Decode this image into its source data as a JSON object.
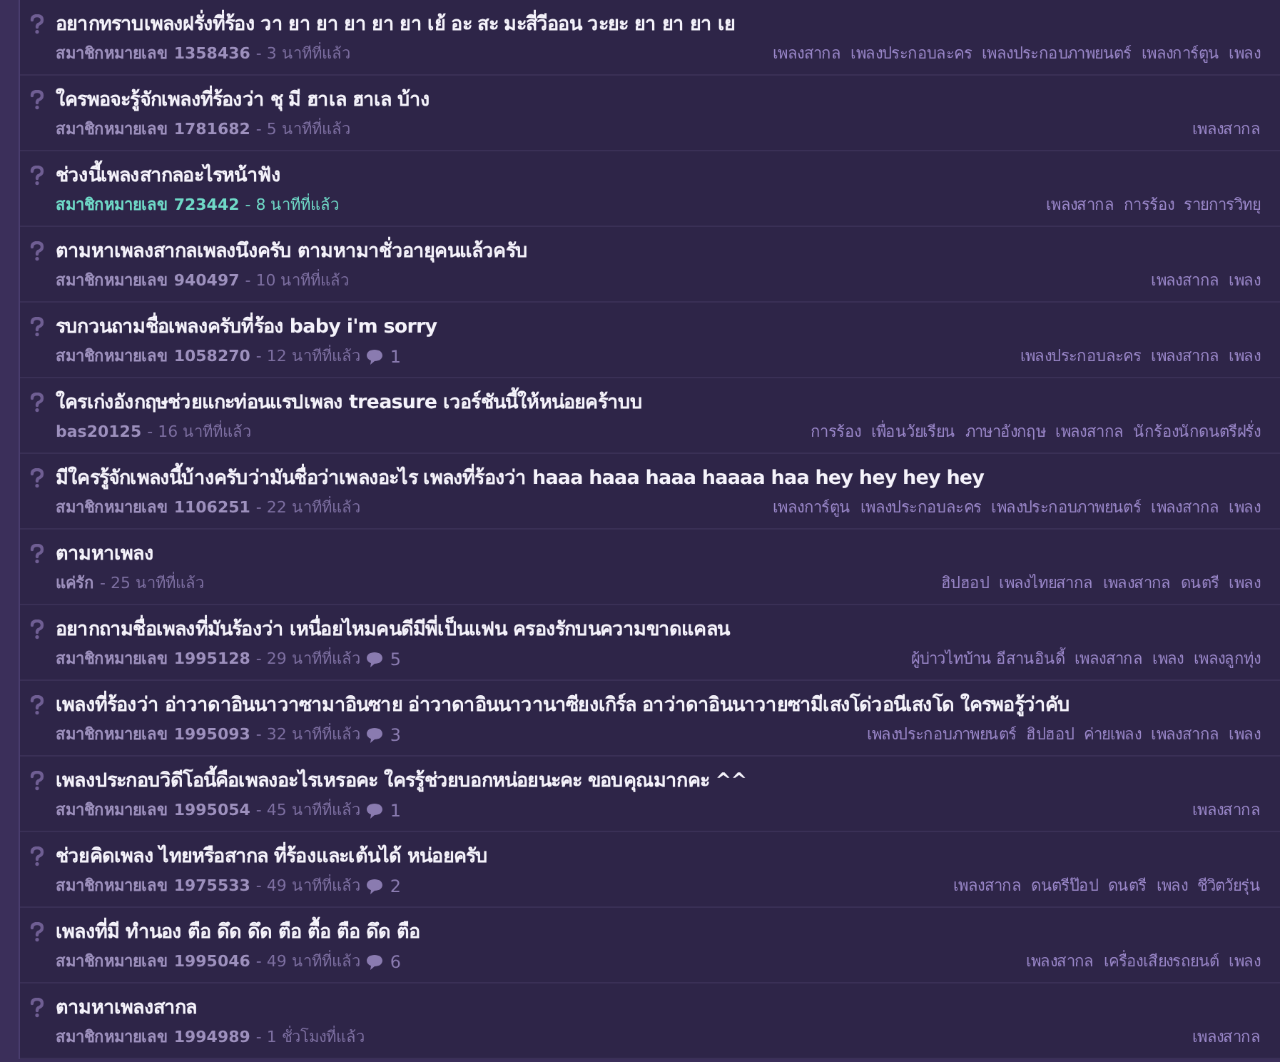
{
  "topics": [
    {
      "title": "อยากทราบเพลงฝรั่งที่ร้อง วา ยา ยา ยา ยา ยา เย้ อะ สะ มะสี่วีออน วะยะ ยา ยา ยา เย",
      "author": "สมาชิกหมายเลข 1358436",
      "time": "- 3 นาทีที่แล้ว",
      "highlighted": false,
      "tags": [
        "เพลงสากล",
        "เพลงประกอบละคร",
        "เพลงประกอบภาพยนตร์",
        "เพลงการ์ตูน",
        "เพลง"
      ]
    },
    {
      "title": "ใครพอจะรู้จักเพลงที่ร้องว่า ชุ มี ฮาเล ฮาเล บ้าง",
      "author": "สมาชิกหมายเลข 1781682",
      "time": "- 5 นาทีที่แล้ว",
      "highlighted": false,
      "tags": [
        "เพลงสากล"
      ]
    },
    {
      "title": "ช่วงนี้เพลงสากลอะไรหน้าฟัง",
      "author": "สมาชิกหมายเลข 723442",
      "time": "- 8 นาทีที่แล้ว",
      "highlighted": true,
      "tags": [
        "เพลงสากล",
        "การร้อง",
        "รายการวิทยุ"
      ]
    },
    {
      "title": "ตามหาเพลงสากลเพลงนึงครับ ตามหามาชั่วอายุคนแล้วครับ",
      "author": "สมาชิกหมายเลข 940497",
      "time": "- 10 นาทีที่แล้ว",
      "highlighted": false,
      "tags": [
        "เพลงสากล",
        "เพลง"
      ]
    },
    {
      "title": "รบกวนถามชื่อเพลงครับที่ร้อง baby i'm sorry",
      "author": "สมาชิกหมายเลข 1058270",
      "time": "- 12 นาทีที่แล้ว",
      "comments": "1",
      "highlighted": false,
      "tags": [
        "เพลงประกอบละคร",
        "เพลงสากล",
        "เพลง"
      ]
    },
    {
      "title": "ใครเก่งอังกฤษช่วยแกะท่อนแรปเพลง treasure เวอร์ชันนี้ให้หน่อยคร้าบบ",
      "author": "bas20125",
      "time": "- 16 นาทีที่แล้ว",
      "highlighted": false,
      "tags": [
        "การร้อง",
        "เพื่อนวัยเรียน",
        "ภาษาอังกฤษ",
        "เพลงสากล",
        "นักร้องนักดนตรีฝรั่ง"
      ]
    },
    {
      "title": "มีใครรู้จักเพลงนี้บ้างครับว่ามันชื่อว่าเพลงอะไร เพลงที่ร้องว่า haaa haaa haaa haaaa haa hey hey hey hey",
      "author": "สมาชิกหมายเลข 1106251",
      "time": "- 22 นาทีที่แล้ว",
      "highlighted": false,
      "tags": [
        "เพลงการ์ตูน",
        "เพลงประกอบละคร",
        "เพลงประกอบภาพยนตร์",
        "เพลงสากล",
        "เพลง"
      ]
    },
    {
      "title": "ตามหาเพลง",
      "author": "แค่รัก",
      "time": "- 25 นาทีที่แล้ว",
      "highlighted": false,
      "tags": [
        "ฮิปฮอป",
        "เพลงไทยสากล",
        "เพลงสากล",
        "ดนตรี",
        "เพลง"
      ]
    },
    {
      "title": "อยากถามชื่อเพลงที่มันร้องว่า เหนื่อยไหมคนดีมีพี่เป็นแฟน ครองรักบนความขาดแคลน",
      "author": "สมาชิกหมายเลข 1995128",
      "time": "- 29 นาทีที่แล้ว",
      "comments": "5",
      "highlighted": false,
      "tags": [
        "ผู้บ่าวไทบ้าน อีสานอินดี้",
        "เพลงสากล",
        "เพลง",
        "เพลงลูกทุ่ง"
      ]
    },
    {
      "title": "เพลงที่ร้องว่า อ่าวาดาอินนาวาซามาอินซาย อ่าวาดาอินนาวานาซียงเกิร์ล อาว่าดาอินนาวายซามีเสงโด่วอนีเสงโด ใครพอรู้ว่าคับ",
      "author": "สมาชิกหมายเลข 1995093",
      "time": "- 32 นาทีที่แล้ว",
      "comments": "3",
      "highlighted": false,
      "tags": [
        "เพลงประกอบภาพยนตร์",
        "ฮิปฮอป",
        "ค่ายเพลง",
        "เพลงสากล",
        "เพลง"
      ]
    },
    {
      "title": "เพลงประกอบวิดีโอนี้คือเพลงอะไรเหรอคะ ใครรู้ช่วยบอกหน่อยนะคะ ขอบคุณมากคะ ^^",
      "author": "สมาชิกหมายเลข 1995054",
      "time": "- 45 นาทีที่แล้ว",
      "comments": "1",
      "highlighted": false,
      "tags": [
        "เพลงสากล"
      ]
    },
    {
      "title": "ช่วยคิดเพลง ไทยหรือสากล ที่ร้องและเต้นได้ หน่อยครับ",
      "author": "สมาชิกหมายเลข 1975533",
      "time": "- 49 นาทีที่แล้ว",
      "comments": "2",
      "highlighted": false,
      "tags": [
        "เพลงสากล",
        "ดนตรีป๊อป",
        "ดนตรี",
        "เพลง",
        "ชีวิตวัยรุ่น"
      ]
    },
    {
      "title": "เพลงที่มี ทำนอง ตือ ดึด ดึด ตือ ตื้อ ตือ ดึด ตือ",
      "author": "สมาชิกหมายเลข 1995046",
      "time": "- 49 นาทีที่แล้ว",
      "comments": "6",
      "highlighted": false,
      "tags": [
        "เพลงสากล",
        "เครื่องเสียงรถยนต์",
        "เพลง"
      ]
    },
    {
      "title": "ตามหาเพลงสากล",
      "author": "สมาชิกหมายเลข 1994989",
      "time": "- 1 ชั่วโมงที่แล้ว",
      "highlighted": false,
      "tags": [
        "เพลงสากล"
      ]
    }
  ]
}
